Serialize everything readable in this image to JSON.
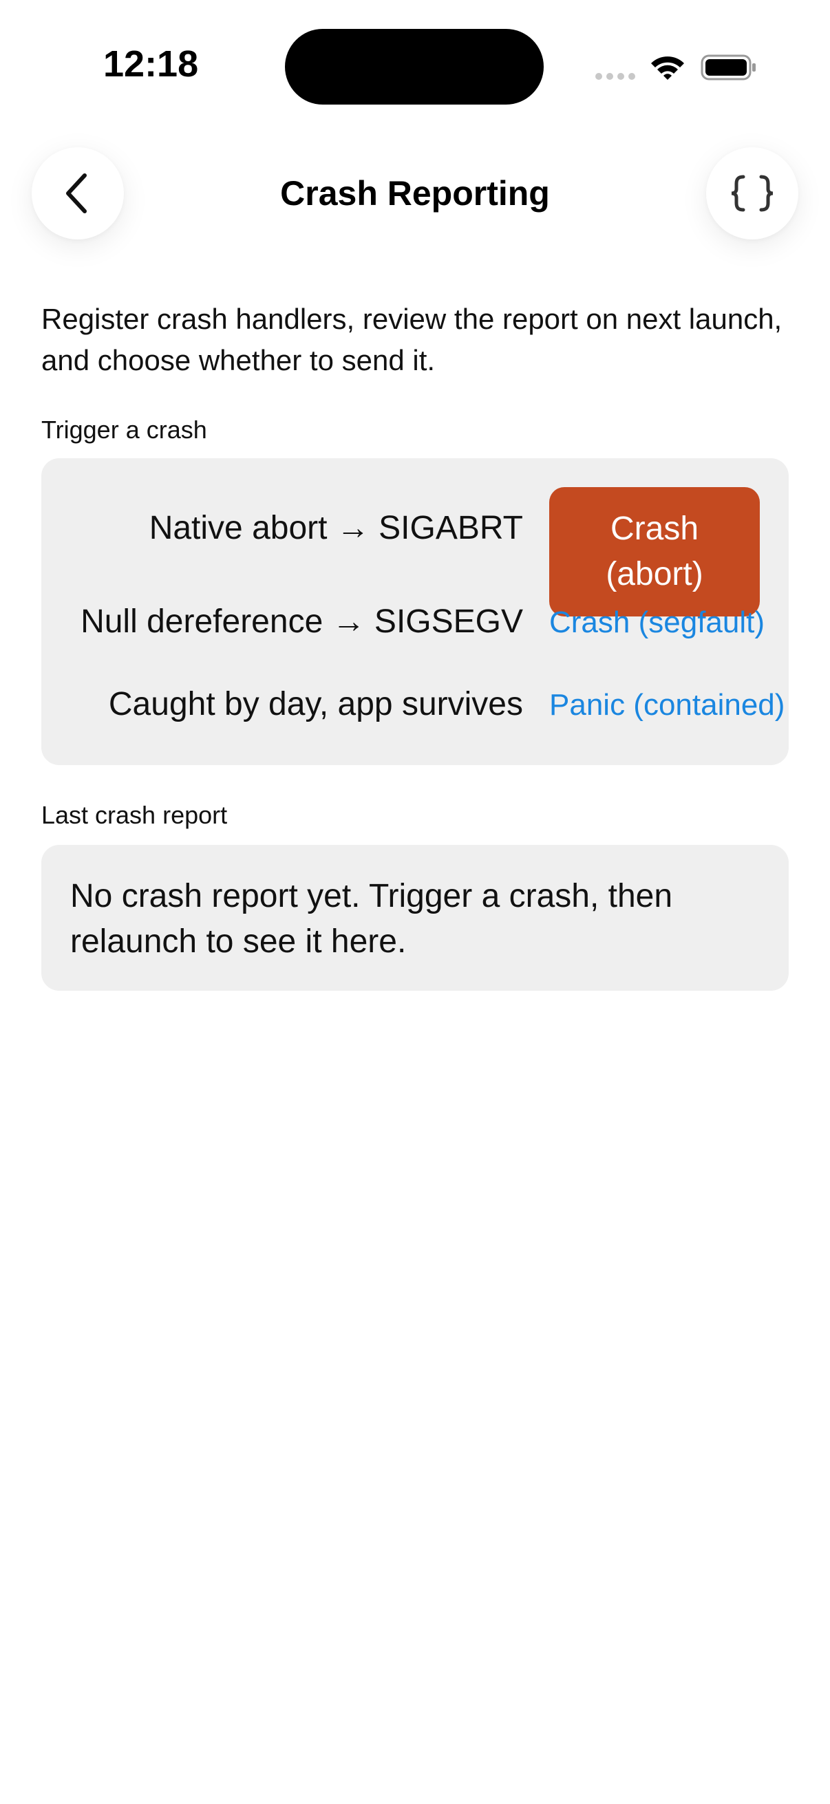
{
  "status_bar": {
    "time": "12:18"
  },
  "header": {
    "title": "Crash Reporting",
    "back_icon": "chevron-left-icon",
    "code_icon": "braces-icon"
  },
  "description": "Register crash handlers, review the report on next launch, and choose whether to send it.",
  "trigger_section": {
    "label": "Trigger a crash",
    "rows": [
      {
        "label": "Native abort → SIGABRT",
        "button": "Crash\n(abort)"
      },
      {
        "label": "Null dereference → SIGSEGV",
        "button": "Crash (segfault)"
      },
      {
        "label": "Caught by day, app survives",
        "button": "Panic (contained)"
      }
    ]
  },
  "last_report_section": {
    "label": "Last crash report",
    "message": "No crash report yet. Trigger a crash, then relaunch to see it here."
  },
  "colors": {
    "accent_red": "#c44a20",
    "link_blue": "#1a86e0",
    "card_bg": "#efefef"
  }
}
